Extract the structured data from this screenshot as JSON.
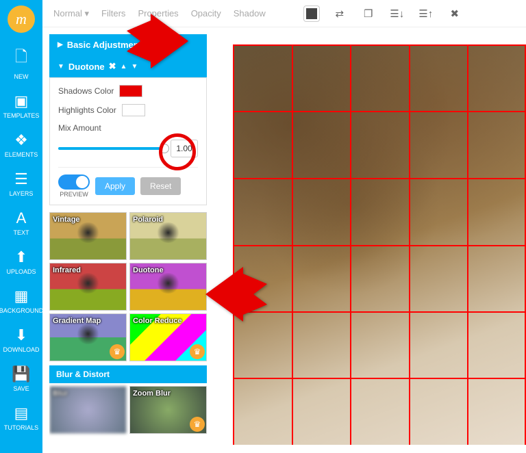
{
  "sidebar": {
    "logo": "m",
    "items": [
      {
        "label": "NEW"
      },
      {
        "label": "TEMPLATES"
      },
      {
        "label": "ELEMENTS"
      },
      {
        "label": "LAYERS"
      },
      {
        "label": "TEXT"
      },
      {
        "label": "UPLOADS"
      },
      {
        "label": "BACKGROUND"
      },
      {
        "label": "DOWNLOAD"
      },
      {
        "label": "SAVE"
      },
      {
        "label": "TUTORIALS"
      }
    ]
  },
  "topbar": {
    "tabs": [
      "Normal",
      "Filters",
      "Properties",
      "Opacity",
      "Shadow"
    ]
  },
  "panel": {
    "basic": "Basic Adjustments",
    "duotone": {
      "title": "Duotone",
      "shadows_label": "Shadows Color",
      "highlights_label": "Highlights Color",
      "mix_label": "Mix Amount",
      "mix_value": "1.00",
      "preview": "PREVIEW",
      "apply": "Apply",
      "reset": "Reset"
    },
    "filters": [
      {
        "label": "Vintage"
      },
      {
        "label": "Polaroid"
      },
      {
        "label": "Infrared"
      },
      {
        "label": "Duotone"
      },
      {
        "label": "Gradient Map"
      },
      {
        "label": "Color Reduce"
      }
    ],
    "blur_section": "Blur & Distort",
    "blur_filters": [
      {
        "label": "Blur"
      },
      {
        "label": "Zoom Blur"
      }
    ]
  }
}
